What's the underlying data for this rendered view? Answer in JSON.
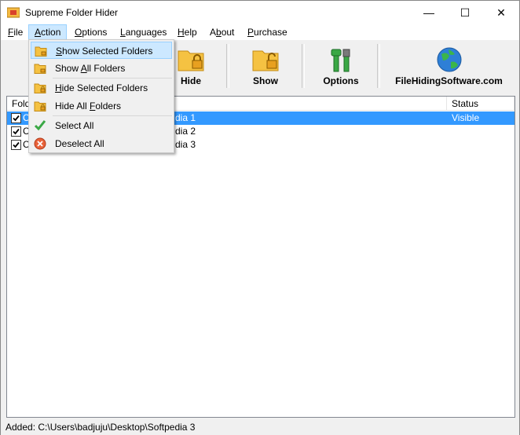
{
  "window": {
    "title": "Supreme Folder Hider",
    "minimize_glyph": "—",
    "maximize_glyph": "☐",
    "close_glyph": "✕"
  },
  "menubar": {
    "items": [
      {
        "label": "File",
        "underline": "F"
      },
      {
        "label": "Action",
        "underline": "A"
      },
      {
        "label": "Options",
        "underline": "O"
      },
      {
        "label": "Languages",
        "underline": "L"
      },
      {
        "label": "Help",
        "underline": "H"
      },
      {
        "label": "About",
        "underline": "b"
      },
      {
        "label": "Purchase",
        "underline": "P"
      }
    ]
  },
  "toolbar": {
    "hide_label": "Hide",
    "show_label": "Show",
    "options_label": "Options",
    "website_label": "FileHidingSoftware.com",
    "icons": [
      "folder-lock-icon",
      "folder-unlock-icon",
      "tools-icon",
      "globe-icon"
    ]
  },
  "list": {
    "columns": [
      "Fold",
      "Status"
    ],
    "rows": [
      {
        "name_tail": "dia 1",
        "name_head": "C",
        "status": "Visible",
        "checked": true,
        "selected": true
      },
      {
        "name_tail": "dia 2",
        "name_head": "C",
        "status": "",
        "checked": true,
        "selected": false
      },
      {
        "name_tail": "dia 3",
        "name_head": "C",
        "status": "",
        "checked": true,
        "selected": false
      }
    ]
  },
  "action_menu": {
    "items": [
      {
        "label": "Show Selected Folders",
        "icon": "folder-unlock-icon"
      },
      {
        "label": "Show All Folders",
        "icon": "folder-unlock-icon"
      },
      {
        "label": "Hide Selected Folders",
        "icon": "folder-lock-icon"
      },
      {
        "label": "Hide All Folders",
        "icon": "folder-lock-icon"
      },
      {
        "label": "Select All",
        "icon": "checkmark-icon"
      },
      {
        "label": "Deselect All",
        "icon": "deselect-icon"
      }
    ]
  },
  "statusbar": {
    "text": "Added: C:\\Users\\badjuju\\Desktop\\Softpedia 3"
  },
  "colors": {
    "selection": "#3399ff",
    "menu_highlight": "#cce8ff",
    "folder": "#f5c242"
  }
}
